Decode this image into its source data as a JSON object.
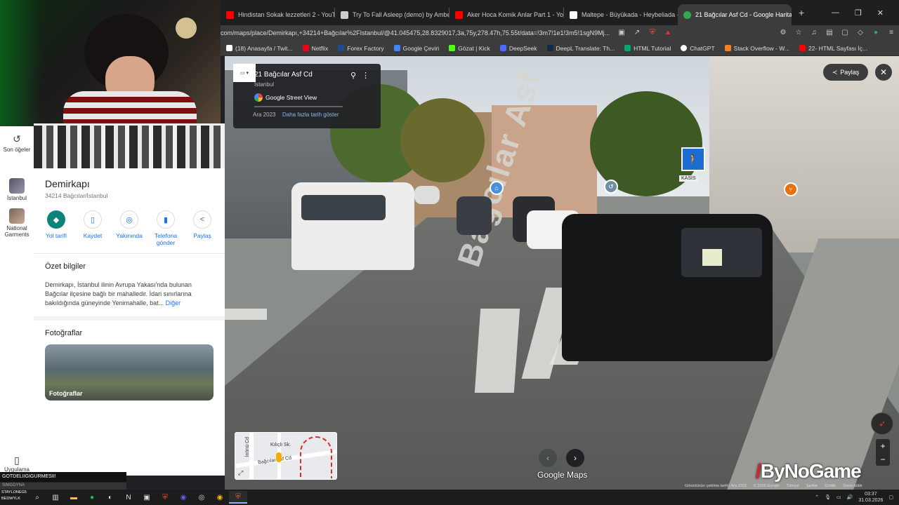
{
  "browser": {
    "tabs": [
      {
        "title": "Hindistan Sokak lezzetleri 2 - YouTube",
        "color": "#ff0000"
      },
      {
        "title": "Try To Fall Asleep (demo) by Amber",
        "color": "#cccccc"
      },
      {
        "title": "Aker Hoca Komik Anlar Part 1 - YouT",
        "color": "#ff0000"
      },
      {
        "title": "Maltepe - Büyükada - Heybeliada - ",
        "color": "#ffffff"
      },
      {
        "title": "21 Bağcılar Asf Cd - Google Harita",
        "color": "#34a853"
      }
    ],
    "url": "com/maps/place/Demirkapı,+34214+Bağcılar%2FIstanbul/@41.045475,28.8329017,3a,75y,278.47h,75.55t/data=!3m7!1e1!3m5!1sgN9Mj...",
    "bookmarks": [
      {
        "label": "(18) Anasayfa / Twit...",
        "color": "#ffffff"
      },
      {
        "label": "Netflix",
        "color": "#e50914"
      },
      {
        "label": "Forex Factory",
        "color": "#1e4e8c"
      },
      {
        "label": "Google Çeviri",
        "color": "#4285f4"
      },
      {
        "label": "Gözat | Kick",
        "color": "#53fc18"
      },
      {
        "label": "DeepSeek",
        "color": "#4d6bfe"
      },
      {
        "label": "DeepL Translate: Th...",
        "color": "#0f2b46"
      },
      {
        "label": "HTML Tutorial",
        "color": "#04aa6d"
      },
      {
        "label": "ChatGPT",
        "color": "#ffffff"
      },
      {
        "label": "Stack Overflow - W...",
        "color": "#f48024"
      },
      {
        "label": "22- HTML Sayfası İç...",
        "color": "#ff0000"
      }
    ]
  },
  "rail": {
    "recent": "Son öğeler",
    "items": [
      {
        "label": "İstanbul"
      },
      {
        "label": "National Garments"
      }
    ],
    "apps": "Uygulama"
  },
  "place": {
    "title": "Demirkapı",
    "subtitle": "34214 Bağcılar/İstanbul",
    "actions": [
      {
        "label": "Yol tarifi",
        "icon": "directions-icon",
        "glyph": "◆"
      },
      {
        "label": "Kaydet",
        "icon": "bookmark-icon",
        "glyph": "▯"
      },
      {
        "label": "Yakınında",
        "icon": "nearby-icon",
        "glyph": "◎"
      },
      {
        "label": "Telefona gönder",
        "icon": "phone-icon",
        "glyph": "▮"
      },
      {
        "label": "Paylaş",
        "icon": "share-icon",
        "glyph": "<"
      }
    ],
    "summary_title": "Özet bilgiler",
    "summary": "Demirkapı, İstanbul ilinin Avrupa Yakası'nda bulunan Bağcılar ilçesine bağlı bir mahalledir. İdari sınırlarına bakıldığında güneyinde Yenimahalle, bat...",
    "more": "Diğer",
    "photos_title": "Fotoğraflar",
    "photo_label": "Fotoğraflar"
  },
  "streetview": {
    "card_title": "21 Bağcılar Asf Cd",
    "card_subtitle": "İstanbul",
    "provider": "Google Street View",
    "date": "Ara 2023",
    "history_link": "Daha fazla tarih göster",
    "share": "Paylaş",
    "road_text": "Bağcılar Asf",
    "kasis": "KASİS",
    "brand": "Google Maps",
    "minimap_labels": [
      "Kılıçlı Sk.",
      "Bağcılar Asf Cd",
      "İnönü Cd"
    ],
    "footer": [
      "Görüntünün çekilme tarihi: Ara 2023",
      "© 2026 Google",
      "Türkiye",
      "Şartlar",
      "Gizlilik",
      "Sorun bildir"
    ]
  },
  "watermark": {
    "prefix": "/",
    "text": "ByNoGame"
  },
  "stream": {
    "ticker": "GOTDELIIGIGURMESII!",
    "sub": "SIMGDYNA",
    "streamers": [
      "STAYLONEG5",
      "BEDWYLK"
    ]
  },
  "taskbar": {
    "time": "03:37",
    "date": "31.03.2026"
  }
}
